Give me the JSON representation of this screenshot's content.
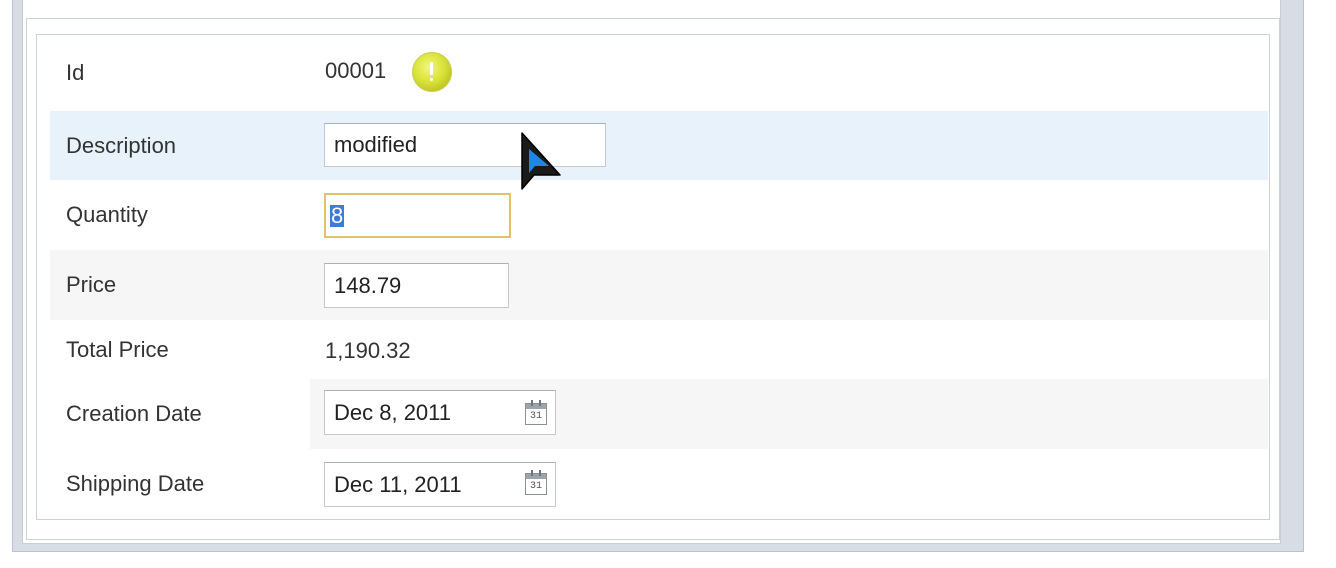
{
  "form": {
    "rows": [
      {
        "label": "Id",
        "value": "00001"
      },
      {
        "label": "Description",
        "value": "modified"
      },
      {
        "label": "Quantity",
        "value": "8"
      },
      {
        "label": "Price",
        "value": "148.79"
      },
      {
        "label": "Total Price",
        "value": "1,190.32"
      },
      {
        "label": "Creation Date",
        "value": "Dec 8, 2011"
      },
      {
        "label": "Shipping Date",
        "value": "Dec 11, 2011"
      }
    ],
    "calendar_day": "31",
    "icons": {
      "status": "warning-icon",
      "calendar": "calendar-icon"
    }
  },
  "colors": {
    "hover_row": "#e8f2fa",
    "alt_row": "#f6f6f6",
    "focus_border": "#e2c26a",
    "selection": "#3d7bd5",
    "warning": "#d8e23a"
  }
}
